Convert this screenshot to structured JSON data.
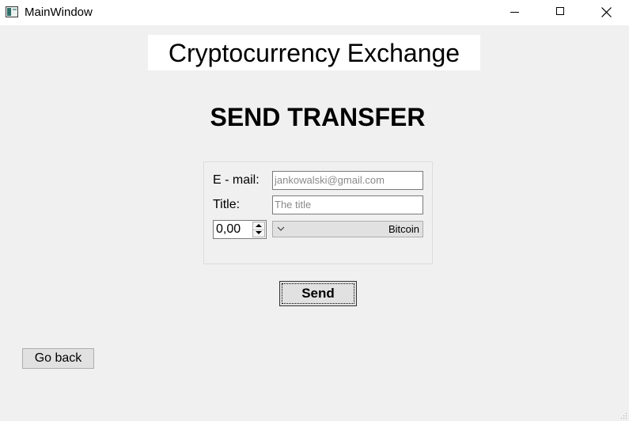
{
  "window": {
    "title": "MainWindow",
    "icon": "app-window-icon",
    "controls": [
      "minimize-icon",
      "maximize-icon",
      "close-icon"
    ]
  },
  "header": {
    "app_title": "Cryptocurrency Exchange",
    "section_title": "SEND TRANSFER"
  },
  "form": {
    "email_label": "E - mail:",
    "email_placeholder": "jankowalski@gmail.com",
    "title_label": "Title:",
    "title_placeholder": "The title",
    "amount_value": "0,00",
    "currency_selected": "Bitcoin"
  },
  "buttons": {
    "send": "Send",
    "go_back": "Go back"
  },
  "colors": {
    "window_bg": "#f0f0f0",
    "titlebar_bg": "#ffffff",
    "button_bg": "#e1e1e1"
  }
}
